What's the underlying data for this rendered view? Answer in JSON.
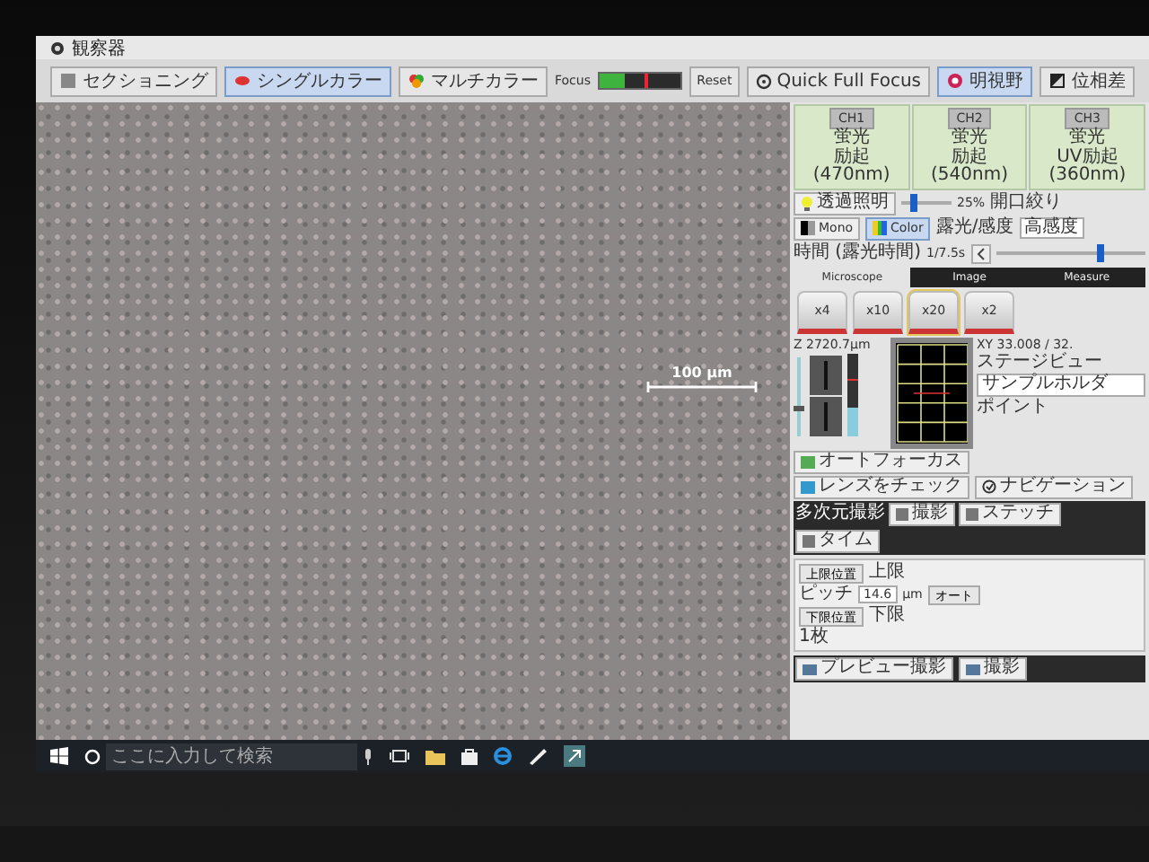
{
  "window": {
    "title": "観察器"
  },
  "toolbar": {
    "buttons": [
      {
        "label": "セクショニング",
        "selected": false
      },
      {
        "label": "シングルカラー",
        "selected": true
      },
      {
        "label": "マルチカラー",
        "selected": false
      }
    ],
    "focus": {
      "label": "Focus",
      "level": 0.3
    },
    "reset": "Reset",
    "quick_full_focus": "Quick Full Focus",
    "modes": [
      {
        "label": "明視野",
        "selected": true
      },
      {
        "label": "位相差",
        "selected": false
      }
    ]
  },
  "image": {
    "scale_bar": "100 μm"
  },
  "panel": {
    "channels": [
      {
        "label": "CH1",
        "line1": "蛍光",
        "line2": "励起 (470nm)"
      },
      {
        "label": "CH2",
        "line1": "蛍光",
        "line2": "励起 (540nm)"
      },
      {
        "label": "CH3",
        "line1": "蛍光",
        "line2": "UV励起 (360nm)"
      }
    ],
    "illumination": {
      "label": "透過照明",
      "level": 0.25,
      "reading": "25%",
      "aperture": "開口絞り"
    },
    "color_modes": [
      {
        "label": "Mono",
        "selected": false
      },
      {
        "label": "Color",
        "selected": true
      }
    ],
    "sensitivity": {
      "label": "露光/感度",
      "value": "高感度"
    },
    "exposure": {
      "label": "時間 (露光時間)",
      "reading": "1/7.5s",
      "level": 0.7
    },
    "tabs": [
      {
        "label": "Microscope",
        "selected": true
      },
      {
        "label": "Image",
        "selected": false
      },
      {
        "label": "Measure",
        "selected": false
      }
    ],
    "objectives": [
      {
        "label": "x4",
        "selected": false
      },
      {
        "label": "x10",
        "selected": false
      },
      {
        "label": "x20",
        "selected": true
      },
      {
        "label": "x2",
        "selected": false
      }
    ],
    "z": {
      "reading": "Z 2720.7μm",
      "level": 0.3
    },
    "stage": {
      "xy": "XY 33.008 / 32.",
      "view": "ステージビュー",
      "holder": "サンプルホルダ",
      "point": "ポイント",
      "navigation": "ナビゲーション"
    },
    "autofocus": "オートフォーカス",
    "lens_check": "レンズをチェック",
    "multi": {
      "title": "多次元撮影",
      "buttons": [
        "撮影",
        "ステッチ",
        "タイム"
      ]
    },
    "zstack": {
      "upper_button": "上限位置",
      "upper": "上限",
      "pitch_label": "ピッチ",
      "pitch": "14.6",
      "unit": "μm",
      "auto": "オート",
      "lower_button": "下限位置",
      "lower": "下限",
      "count": "1枚"
    },
    "bottom_buttons": [
      "プレビュー撮影",
      "撮影"
    ]
  },
  "taskbar": {
    "search": {
      "placeholder": "ここに入力して検索"
    }
  }
}
